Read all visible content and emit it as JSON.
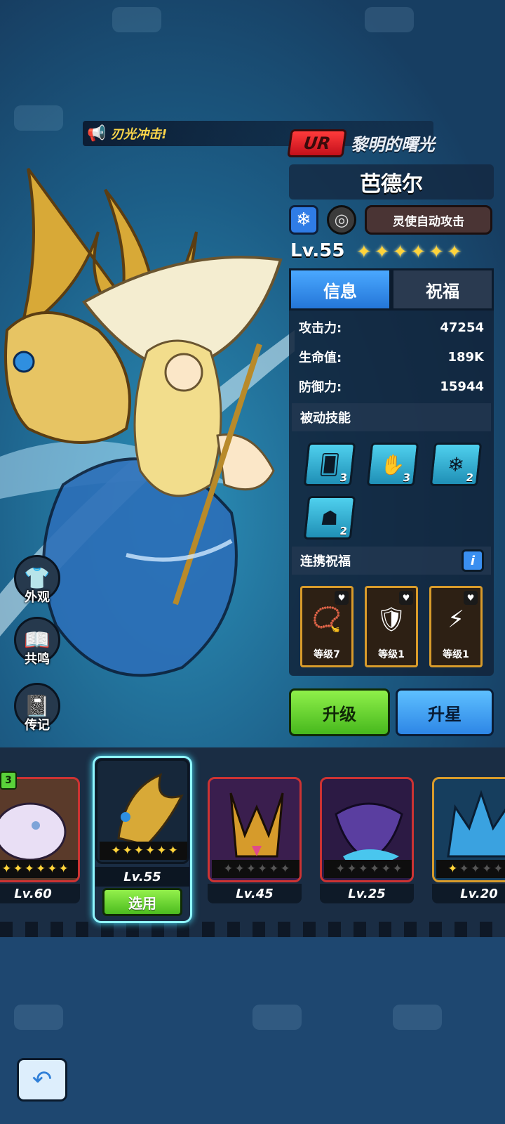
{
  "announcement": {
    "text": "刃光冲击!"
  },
  "hero": {
    "rarity": "UR",
    "title": "黎明的曙光",
    "name": "芭德尔",
    "auto_attack_label": "灵使自动攻击",
    "level": "Lv.55",
    "stars": 6
  },
  "tabs": {
    "info": "信息",
    "blessing": "祝福"
  },
  "stats": [
    {
      "label": "攻击力:",
      "value": "47254"
    },
    {
      "label": "生命值:",
      "value": "189K"
    },
    {
      "label": "防御力:",
      "value": "15944"
    }
  ],
  "passive": {
    "title": "被动技能",
    "skills": [
      {
        "icon": "cards-icon",
        "count": "3"
      },
      {
        "icon": "spiral-hand-icon",
        "count": "3"
      },
      {
        "icon": "snowflake-icon",
        "count": "2"
      },
      {
        "icon": "hooded-figure-icon",
        "count": "2"
      }
    ]
  },
  "link_blessing": {
    "title": "连携祝福",
    "info_label": "i",
    "items": [
      {
        "icon": "beads-icon",
        "label": "等级7"
      },
      {
        "icon": "shield-icon",
        "label": "等级1"
      },
      {
        "icon": "lightning-monster-icon",
        "label": "等级1"
      }
    ]
  },
  "actions": {
    "upgrade": "升级",
    "star_up": "升星"
  },
  "side_menu": [
    {
      "icon": "shirt-icon",
      "label": "外观"
    },
    {
      "icon": "book-icon",
      "label": "共鸣"
    },
    {
      "icon": "journal-icon",
      "label": "传记"
    }
  ],
  "roster": [
    {
      "level": "Lv.60",
      "stars_on": 6,
      "badge": "3",
      "border": "#cc3333"
    },
    {
      "level": "Lv.55",
      "stars_on": 6,
      "selected": true,
      "select_label": "选用",
      "border": "#8ff6ff"
    },
    {
      "level": "Lv.45",
      "stars_on": 0,
      "border": "#cc3333"
    },
    {
      "level": "Lv.25",
      "stars_on": 0,
      "border": "#cc3333"
    },
    {
      "level": "Lv.20",
      "stars_on": 1,
      "border": "#d89b2b"
    }
  ],
  "colors": {
    "accent_blue": "#2476d8",
    "accent_green": "#47b81d",
    "rarity_red": "#c4101b",
    "star_gold": "#ffd43b"
  }
}
